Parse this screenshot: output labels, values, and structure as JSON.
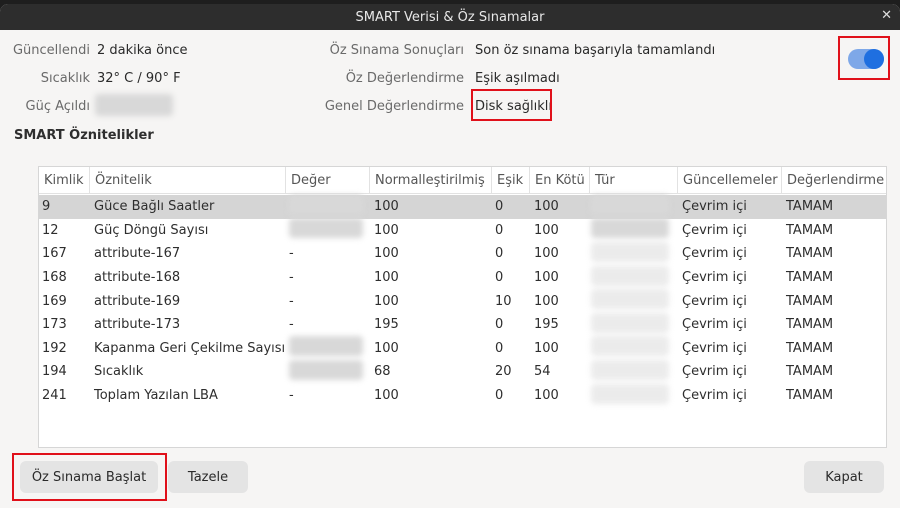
{
  "window": {
    "title": "SMART Verisi & Öz Sınamalar"
  },
  "info": {
    "updated_label": "Güncellendi",
    "updated_value": "2 dakika önce",
    "temp_label": "Sıcaklık",
    "temp_value": "32° C / 90° F",
    "power_label": "Güç Açıldı",
    "selftest_label": "Öz Sınama Sonuçları",
    "selftest_value": "Son öz sınama başarıyla tamamlandı",
    "selfassess_label": "Öz Değerlendirme",
    "selfassess_value": "Eşik aşılmadı",
    "overall_label": "Genel Değerlendirme",
    "overall_value": "Disk sağlıklı"
  },
  "toggle": {
    "on": true
  },
  "section_title": "SMART Öznitelikler",
  "table": {
    "columns": [
      "Kimlik",
      "Öznitelik",
      "Değer",
      "Normalleştirilmiş",
      "Eşik",
      "En Kötü",
      "Tür",
      "Güncellemeler",
      "Değerlendirme"
    ],
    "rows": [
      {
        "id": "9",
        "name": "Güce Bağlı Saatler",
        "value": "",
        "norm": "100",
        "thr": "0",
        "worst": "100",
        "upd": "Çevrim içi",
        "assess": "TAMAM"
      },
      {
        "id": "12",
        "name": "Güç Döngü Sayısı",
        "value": "",
        "norm": "100",
        "thr": "0",
        "worst": "100",
        "upd": "Çevrim içi",
        "assess": "TAMAM"
      },
      {
        "id": "167",
        "name": "attribute-167",
        "value": "-",
        "norm": "100",
        "thr": "0",
        "worst": "100",
        "upd": "Çevrim içi",
        "assess": "TAMAM"
      },
      {
        "id": "168",
        "name": "attribute-168",
        "value": "-",
        "norm": "100",
        "thr": "0",
        "worst": "100",
        "upd": "Çevrim içi",
        "assess": "TAMAM"
      },
      {
        "id": "169",
        "name": "attribute-169",
        "value": "-",
        "norm": "100",
        "thr": "10",
        "worst": "100",
        "upd": "Çevrim içi",
        "assess": "TAMAM"
      },
      {
        "id": "173",
        "name": "attribute-173",
        "value": "-",
        "norm": "195",
        "thr": "0",
        "worst": "195",
        "upd": "Çevrim içi",
        "assess": "TAMAM"
      },
      {
        "id": "192",
        "name": "Kapanma Geri Çekilme Sayısı",
        "value": "",
        "norm": "100",
        "thr": "0",
        "worst": "100",
        "upd": "Çevrim içi",
        "assess": "TAMAM"
      },
      {
        "id": "194",
        "name": "Sıcaklık",
        "value": "",
        "norm": "68",
        "thr": "20",
        "worst": "54",
        "upd": "Çevrim içi",
        "assess": "TAMAM"
      },
      {
        "id": "241",
        "name": "Toplam Yazılan LBA",
        "value": "-",
        "norm": "100",
        "thr": "0",
        "worst": "100",
        "upd": "Çevrim içi",
        "assess": "TAMAM"
      }
    ]
  },
  "buttons": {
    "start": "Öz Sınama Başlat",
    "refresh": "Tazele",
    "close": "Kapat"
  }
}
